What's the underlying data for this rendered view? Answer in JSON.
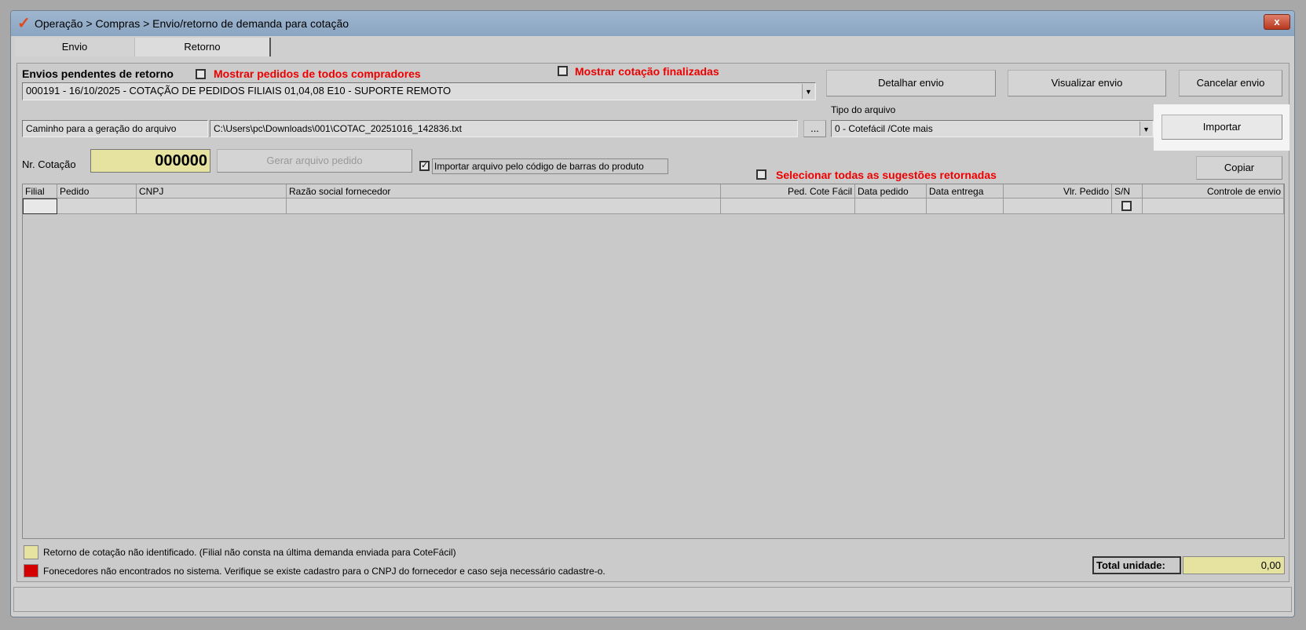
{
  "window": {
    "title": "Operação > Compras > Envio/retorno de demanda para cotação",
    "close": "x"
  },
  "tabs": [
    {
      "label": "Envio"
    },
    {
      "label": "Retorno"
    }
  ],
  "pending": {
    "label": "Envios pendentes de retorno",
    "show_all_buyers": "Mostrar pedidos de todos compradores",
    "show_finalized": "Mostrar cotação finalizadas",
    "selected": "000191 - 16/10/2025 - COTAÇÃO DE PEDIDOS FILIAIS 01,04,08 E10 - SUPORTE REMOTO"
  },
  "buttons": {
    "detalhar": "Detalhar envio",
    "visualizar": "Visualizar envio",
    "cancelar": "Cancelar envio",
    "importar": "Importar",
    "gerar": "Gerar arquivo pedido",
    "copiar": "Copiar",
    "browse": "..."
  },
  "path": {
    "label": "Caminho para a geração do arquivo",
    "value": "C:\\Users\\pc\\Downloads\\001\\COTAC_20251016_142836.txt"
  },
  "file_type": {
    "label": "Tipo do arquivo",
    "value": "0 - Cotefácil /Cote mais"
  },
  "cotacao": {
    "label": "Nr. Cotação",
    "value": "000000"
  },
  "import_barcode": {
    "label": "Importar arquivo pelo código de barras do produto",
    "checked": true
  },
  "select_all": "Selecionar todas as sugestões retornadas",
  "grid": {
    "columns": [
      "Filial",
      "Pedido",
      "CNPJ",
      "Razão social fornecedor",
      "Ped. Cote Fácil",
      "Data pedido",
      "Data entrega",
      "Vlr. Pedido",
      "S/N",
      "Controle de envio"
    ]
  },
  "legend": [
    {
      "color": "#e6e3a0",
      "text": "Retorno de cotação não identificado. (Filial não consta na última demanda enviada para CoteFácil)"
    },
    {
      "color": "#d40000",
      "text": "Fonecedores não encontrados no sistema. Verifique se existe cadastro para o CNPJ do fornecedor e caso seja necessário cadastre-o."
    }
  ],
  "total": {
    "label": "Total unidade:",
    "value": "0,00"
  }
}
